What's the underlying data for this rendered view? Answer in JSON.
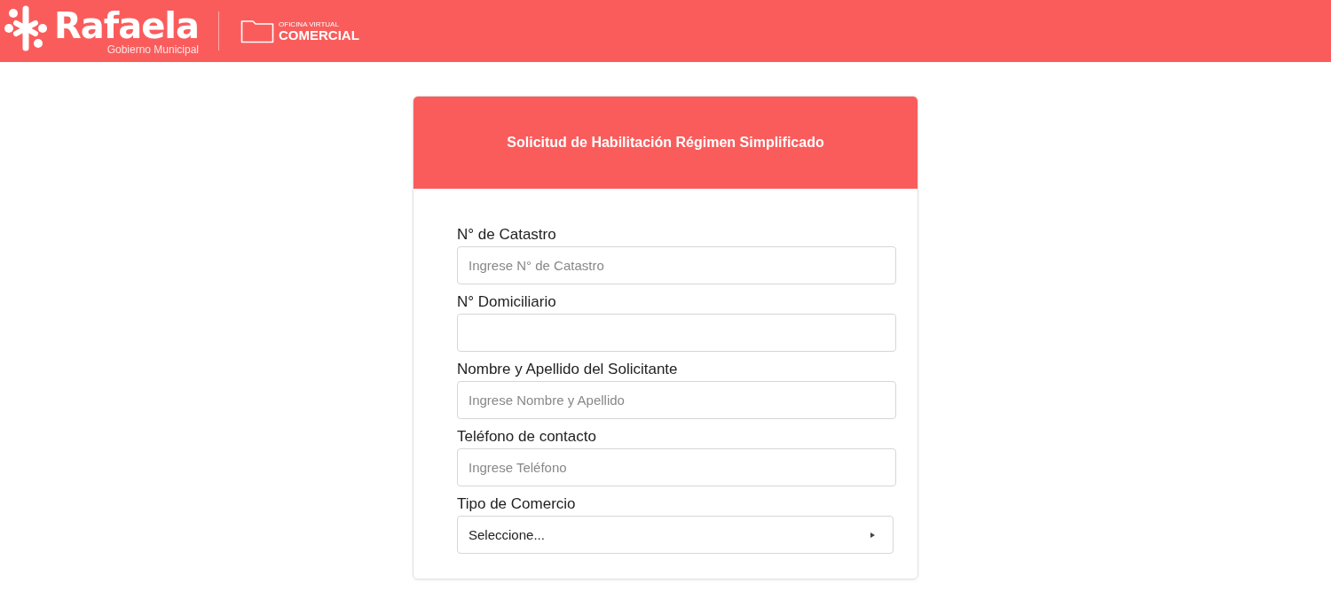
{
  "header": {
    "brand": "Rafaela",
    "brand_subtitle": "Gobierno Municipal",
    "office_small": "OFICINA VIRTUAL",
    "office_large": "COMERCIAL"
  },
  "form": {
    "title": "Solicitud de Habilitación Régimen Simplificado",
    "fields": [
      {
        "kind": "text",
        "label": "N° de Catastro",
        "placeholder": "Ingrese N° de Catastro"
      },
      {
        "kind": "text",
        "label": "N° Domiciliario"
      },
      {
        "kind": "text",
        "label": "Nombre y Apellido del Solicitante",
        "placeholder": "Ingrese Nombre y Apellido"
      },
      {
        "kind": "text",
        "label": "Teléfono de contacto",
        "placeholder": "Ingrese Teléfono"
      },
      {
        "kind": "select",
        "label": "Tipo de Comercio",
        "value": "Seleccione..."
      }
    ]
  }
}
